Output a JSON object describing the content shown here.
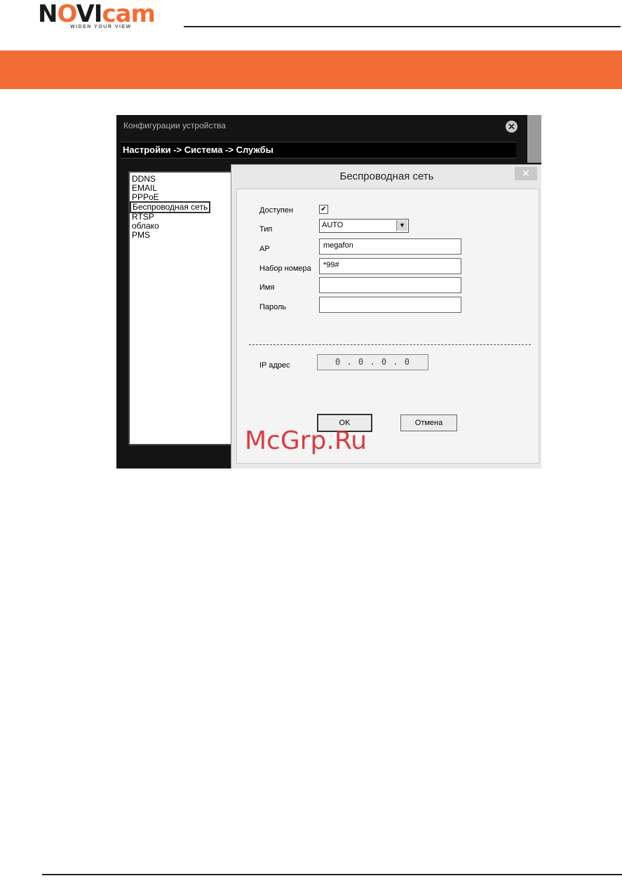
{
  "brand": {
    "logo_main_1": "N",
    "logo_main_2": "O",
    "logo_main_3": "VI",
    "logo_main_4": "cam",
    "tagline": "WIDEN YOUR VIEW",
    "accent_color": "#f26c35"
  },
  "window": {
    "title": "Конфигурации устройства",
    "close_icon": "close-circle-icon",
    "breadcrumb": "Настройки -> Система -> Службы"
  },
  "service_list": {
    "items": [
      {
        "label": "DDNS"
      },
      {
        "label": "EMAIL"
      },
      {
        "label": "PPPoE"
      },
      {
        "label": "Беспроводная сеть"
      },
      {
        "label": "RTSP"
      },
      {
        "label": "облако"
      },
      {
        "label": "PMS"
      }
    ]
  },
  "dialog": {
    "title": "Беспроводная сеть",
    "close_symbol": "✕",
    "enabled_label": "Доступен",
    "enabled_checked": true,
    "type_label": "Тип",
    "type_value": "AUTO",
    "ap_label": "AP",
    "ap_value": "megafon",
    "dial_label": "Набор номера",
    "dial_value": "*99#",
    "name_label": "Имя",
    "name_value": "",
    "password_label": "Пароль",
    "password_value": "",
    "ip_label": "IP адрес",
    "ip_value": "0 . 0 . 0 . 0",
    "ok_label": "OK",
    "cancel_label": "Отмена"
  },
  "watermark": "McGrp.Ru"
}
